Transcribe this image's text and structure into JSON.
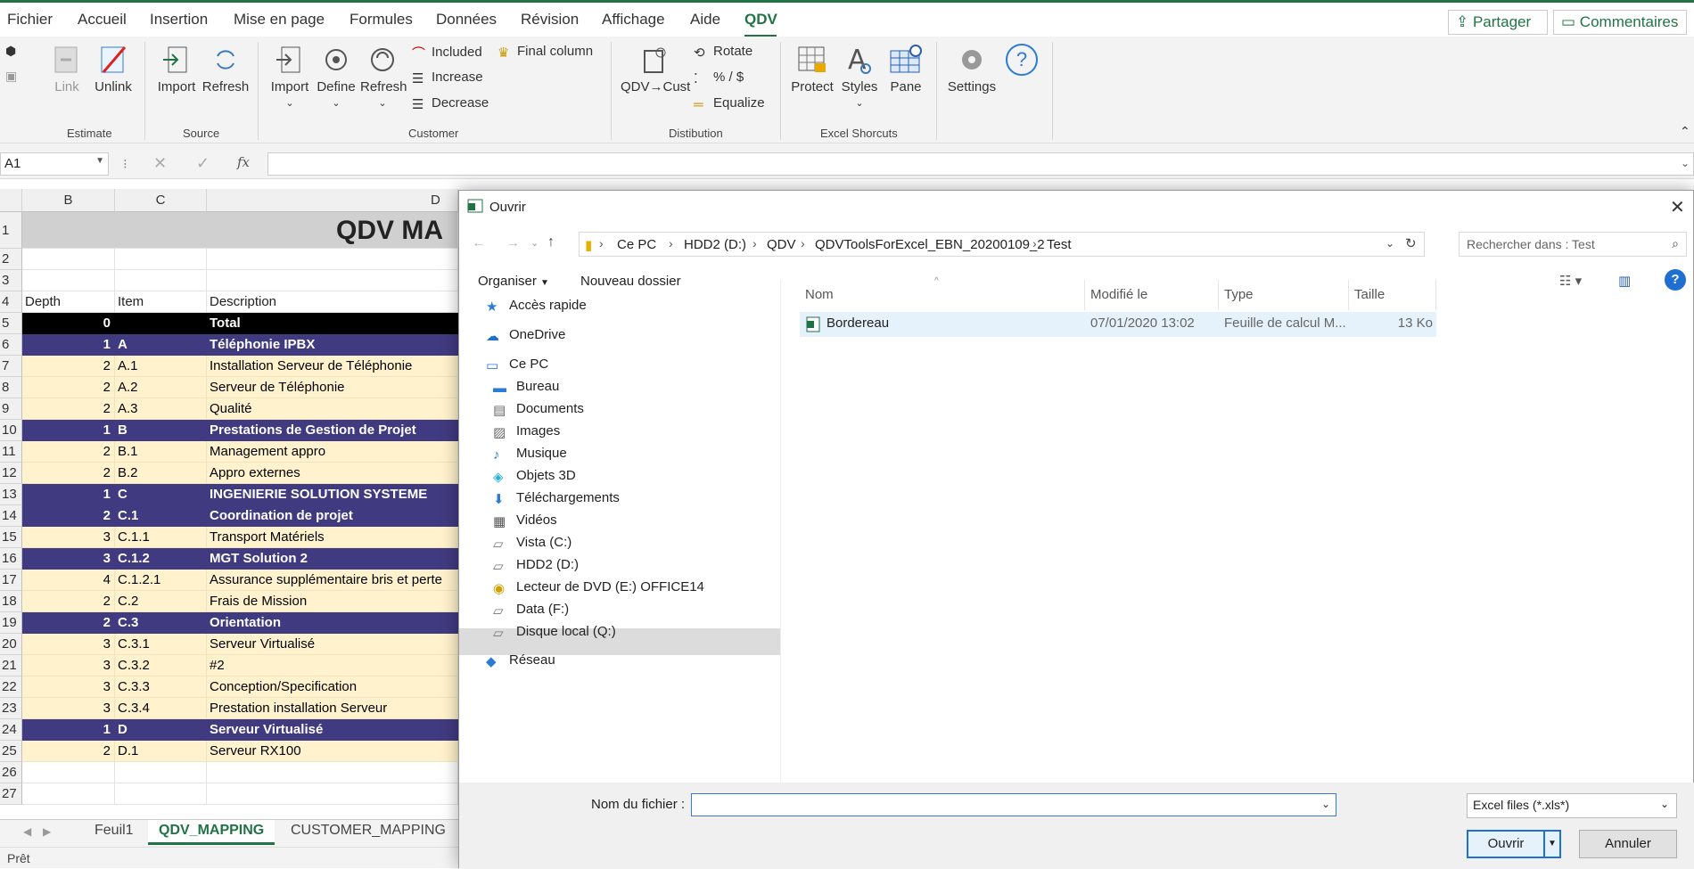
{
  "menu": {
    "tabs": [
      "Fichier",
      "Accueil",
      "Insertion",
      "Mise en page",
      "Formules",
      "Données",
      "Révision",
      "Affichage",
      "Aide",
      "QDV"
    ],
    "share_label": "Partager",
    "comments_label": "Commentaires"
  },
  "ribbon": {
    "estimate": {
      "label": "Estimate",
      "link": "Link",
      "unlink": "Unlink"
    },
    "source": {
      "label": "Source",
      "import": "Import",
      "refresh": "Refresh"
    },
    "customer": {
      "label": "Customer",
      "import": "Import",
      "define": "Define",
      "refresh": "Refresh",
      "included": "Included",
      "increase": "Increase",
      "decrease": "Decrease",
      "final_column": "Final column"
    },
    "distribution": {
      "label": "Distibution",
      "qdv_cust": "QDV→Cust",
      "rotate": "Rotate",
      "percent": "% / $",
      "equalize": "Equalize"
    },
    "excel": {
      "label": "Excel Shorcuts",
      "protect": "Protect",
      "styles": "Styles",
      "pane": "Pane"
    },
    "settings": "Settings",
    "help": "?"
  },
  "formula_bar": {
    "name_box": "A1",
    "fx": "fx",
    "value": ""
  },
  "sheet": {
    "columns": [
      "B",
      "C",
      "D"
    ],
    "title": "QDV MA",
    "headers": {
      "depth": "Depth",
      "item": "Item",
      "description": "Description"
    },
    "rows": [
      {
        "n": "1"
      },
      {
        "n": "2"
      },
      {
        "n": "3"
      },
      {
        "n": "4"
      },
      {
        "n": "5",
        "depth": "0",
        "item": "",
        "desc": "Total",
        "style": "black"
      },
      {
        "n": "6",
        "depth": "1",
        "item": "A",
        "desc": "Téléphonie IPBX",
        "style": "purple"
      },
      {
        "n": "7",
        "depth": "2",
        "item": "A.1",
        "desc": "Installation Serveur de Téléphonie",
        "style": "cream"
      },
      {
        "n": "8",
        "depth": "2",
        "item": "A.2",
        "desc": "Serveur de Téléphonie",
        "style": "cream"
      },
      {
        "n": "9",
        "depth": "2",
        "item": "A.3",
        "desc": "Qualité",
        "style": "cream"
      },
      {
        "n": "10",
        "depth": "1",
        "item": "B",
        "desc": "Prestations de Gestion de Projet",
        "style": "purple"
      },
      {
        "n": "11",
        "depth": "2",
        "item": "B.1",
        "desc": "Management appro",
        "style": "cream"
      },
      {
        "n": "12",
        "depth": "2",
        "item": "B.2",
        "desc": "Appro externes",
        "style": "cream"
      },
      {
        "n": "13",
        "depth": "1",
        "item": "C",
        "desc": "INGENIERIE SOLUTION SYSTEME",
        "style": "purple"
      },
      {
        "n": "14",
        "depth": "2",
        "item": "C.1",
        "desc": "Coordination de projet",
        "style": "purple"
      },
      {
        "n": "15",
        "depth": "3",
        "item": "C.1.1",
        "desc": "Transport Matériels",
        "style": "cream"
      },
      {
        "n": "16",
        "depth": "3",
        "item": "C.1.2",
        "desc": "MGT Solution 2",
        "style": "purple"
      },
      {
        "n": "17",
        "depth": "4",
        "item": "C.1.2.1",
        "desc": "Assurance supplémentaire bris et perte",
        "style": "cream"
      },
      {
        "n": "18",
        "depth": "2",
        "item": "C.2",
        "desc": "Frais de Mission",
        "style": "cream"
      },
      {
        "n": "19",
        "depth": "2",
        "item": "C.3",
        "desc": "Orientation",
        "style": "purple"
      },
      {
        "n": "20",
        "depth": "3",
        "item": "C.3.1",
        "desc": "Serveur Virtualisé",
        "style": "cream"
      },
      {
        "n": "21",
        "depth": "3",
        "item": "C.3.2",
        "desc": "#2",
        "style": "cream"
      },
      {
        "n": "22",
        "depth": "3",
        "item": "C.3.3",
        "desc": "Conception/Specification",
        "style": "cream"
      },
      {
        "n": "23",
        "depth": "3",
        "item": "C.3.4",
        "desc": "Prestation installation Serveur",
        "style": "cream"
      },
      {
        "n": "24",
        "depth": "1",
        "item": "D",
        "desc": "Serveur Virtualisé",
        "style": "purple"
      },
      {
        "n": "25",
        "depth": "2",
        "item": "D.1",
        "desc": "Serveur RX100",
        "style": "cream"
      },
      {
        "n": "26"
      },
      {
        "n": "27"
      }
    ],
    "tabs": [
      "Feuil1",
      "QDV_MAPPING",
      "CUSTOMER_MAPPING"
    ],
    "active_tab": "QDV_MAPPING"
  },
  "status": "Prêt",
  "colors": {
    "excel_green": "#217346",
    "purple_row": "#403a80",
    "cream_row": "#fff2cc",
    "title_gray": "#d0d0d0"
  },
  "dialog": {
    "title": "Ouvrir",
    "breadcrumbs": [
      "Ce PC",
      "HDD2 (D:)",
      "QDV",
      "QDVToolsForExcel_EBN_20200109_2",
      "Test"
    ],
    "search_placeholder": "Rechercher dans : Test",
    "organize": "Organiser",
    "new_folder": "Nouveau dossier",
    "nav": [
      {
        "label": "Accès rapide",
        "icon": "star-icon",
        "indent": 0
      },
      {
        "label": "OneDrive",
        "icon": "cloud-icon",
        "indent": 0
      },
      {
        "label": "Ce PC",
        "icon": "computer-icon",
        "indent": 0
      },
      {
        "label": "Bureau",
        "icon": "desktop-icon",
        "indent": 1
      },
      {
        "label": "Documents",
        "icon": "documents-icon",
        "indent": 1
      },
      {
        "label": "Images",
        "icon": "images-icon",
        "indent": 1
      },
      {
        "label": "Musique",
        "icon": "music-icon",
        "indent": 1
      },
      {
        "label": "Objets 3D",
        "icon": "cube-icon",
        "indent": 1
      },
      {
        "label": "Téléchargements",
        "icon": "download-icon",
        "indent": 1
      },
      {
        "label": "Vidéos",
        "icon": "video-icon",
        "indent": 1
      },
      {
        "label": "Vista (C:)",
        "icon": "drive-icon",
        "indent": 1
      },
      {
        "label": "HDD2 (D:)",
        "icon": "drive-icon",
        "indent": 1
      },
      {
        "label": "Lecteur de DVD (E:) OFFICE14",
        "icon": "dvd-icon",
        "indent": 1
      },
      {
        "label": "Data (F:)",
        "icon": "drive-icon",
        "indent": 1
      },
      {
        "label": "Disque local (Q:)",
        "icon": "drive-icon",
        "indent": 1
      },
      {
        "label": "Réseau",
        "icon": "network-icon",
        "indent": 0
      }
    ],
    "selected_nav": "HDD2 (D:)",
    "columns": {
      "name": "Nom",
      "modified": "Modifié le",
      "type": "Type",
      "size": "Taille"
    },
    "files": [
      {
        "name": "Bordereau",
        "modified": "07/01/2020 13:02",
        "type": "Feuille de calcul M...",
        "size": "13 Ko"
      }
    ],
    "filename_label": "Nom du fichier :",
    "filename_value": "",
    "filter": "Excel files (*.xls*)",
    "open": "Ouvrir",
    "cancel": "Annuler"
  }
}
